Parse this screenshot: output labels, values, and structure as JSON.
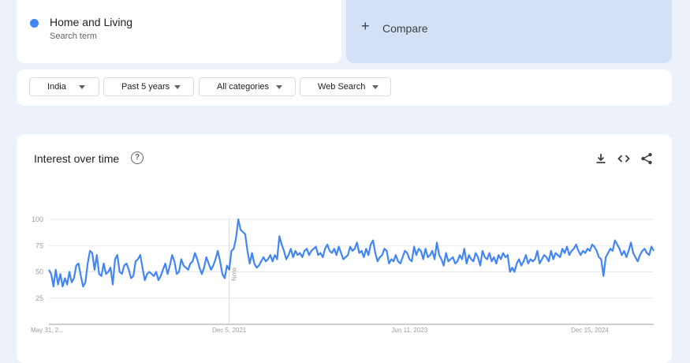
{
  "search_term": {
    "name": "Home and Living",
    "subtitle": "Search term",
    "color": "#4285f4"
  },
  "compare": {
    "plus": "+",
    "label": "Compare"
  },
  "filters": [
    {
      "label": "India"
    },
    {
      "label": "Past 5 years"
    },
    {
      "label": "All categories"
    },
    {
      "label": "Web Search"
    }
  ],
  "chart_panel": {
    "title": "Interest over time",
    "help_icon": "help-circle-icon",
    "download_icon": "download-icon",
    "embed_icon": "embed-code-icon",
    "share_icon": "share-icon"
  },
  "chart_data": {
    "type": "line",
    "title": "Interest over time",
    "y_ticks": [
      "25",
      "50",
      "75",
      "100"
    ],
    "ylim": [
      0,
      100
    ],
    "x_labels": [
      {
        "label": "May 31, 2...",
        "index": 0
      },
      {
        "label": "Dec 5, 2021",
        "index": 79
      },
      {
        "label": "Jun 11, 2023",
        "index": 158
      },
      {
        "label": "Dec 15, 2024",
        "index": 237
      }
    ],
    "annotation": {
      "label": "Note",
      "index": 79
    },
    "grid": true,
    "series": [
      {
        "color": "#4285f4",
        "values": [
          52,
          48,
          36,
          52,
          38,
          48,
          36,
          44,
          38,
          50,
          40,
          44,
          56,
          58,
          46,
          36,
          40,
          58,
          70,
          68,
          52,
          66,
          48,
          46,
          58,
          48,
          50,
          54,
          38,
          62,
          66,
          50,
          48,
          56,
          58,
          52,
          44,
          46,
          60,
          62,
          66,
          54,
          42,
          48,
          50,
          48,
          46,
          50,
          42,
          46,
          52,
          58,
          48,
          56,
          66,
          60,
          48,
          50,
          62,
          56,
          54,
          52,
          58,
          60,
          68,
          62,
          54,
          48,
          54,
          64,
          58,
          52,
          56,
          62,
          70,
          60,
          48,
          44,
          56,
          52,
          70,
          72,
          82,
          100,
          90,
          88,
          86,
          70,
          58,
          68,
          58,
          54,
          56,
          60,
          64,
          60,
          62,
          66,
          60,
          66,
          62,
          84,
          76,
          70,
          62,
          66,
          72,
          64,
          70,
          66,
          68,
          64,
          70,
          72,
          66,
          70,
          72,
          74,
          66,
          68,
          64,
          72,
          76,
          70,
          68,
          72,
          66,
          74,
          68,
          62,
          64,
          66,
          74,
          70,
          72,
          78,
          68,
          70,
          64,
          72,
          66,
          76,
          80,
          68,
          60,
          64,
          66,
          72,
          70,
          58,
          62,
          60,
          66,
          60,
          58,
          64,
          70,
          68,
          62,
          60,
          74,
          66,
          72,
          70,
          62,
          72,
          64,
          66,
          70,
          62,
          78,
          66,
          62,
          56,
          68,
          60,
          62,
          64,
          58,
          60,
          66,
          62,
          72,
          58,
          66,
          62,
          60,
          68,
          64,
          56,
          70,
          64,
          62,
          68,
          60,
          64,
          58,
          66,
          62,
          68,
          64,
          66,
          50,
          54,
          50,
          58,
          62,
          56,
          60,
          66,
          58,
          62,
          60,
          62,
          70,
          58,
          62,
          66,
          64,
          60,
          70,
          62,
          68,
          66,
          64,
          72,
          68,
          74,
          66,
          70,
          72,
          76,
          70,
          66,
          70,
          68,
          72,
          70,
          76,
          74,
          70,
          64,
          62,
          46,
          64,
          68,
          72,
          70,
          80,
          76,
          72,
          66,
          70,
          64,
          70,
          78,
          68,
          64,
          60,
          66,
          70,
          72,
          68,
          66,
          74,
          70
        ]
      }
    ]
  }
}
